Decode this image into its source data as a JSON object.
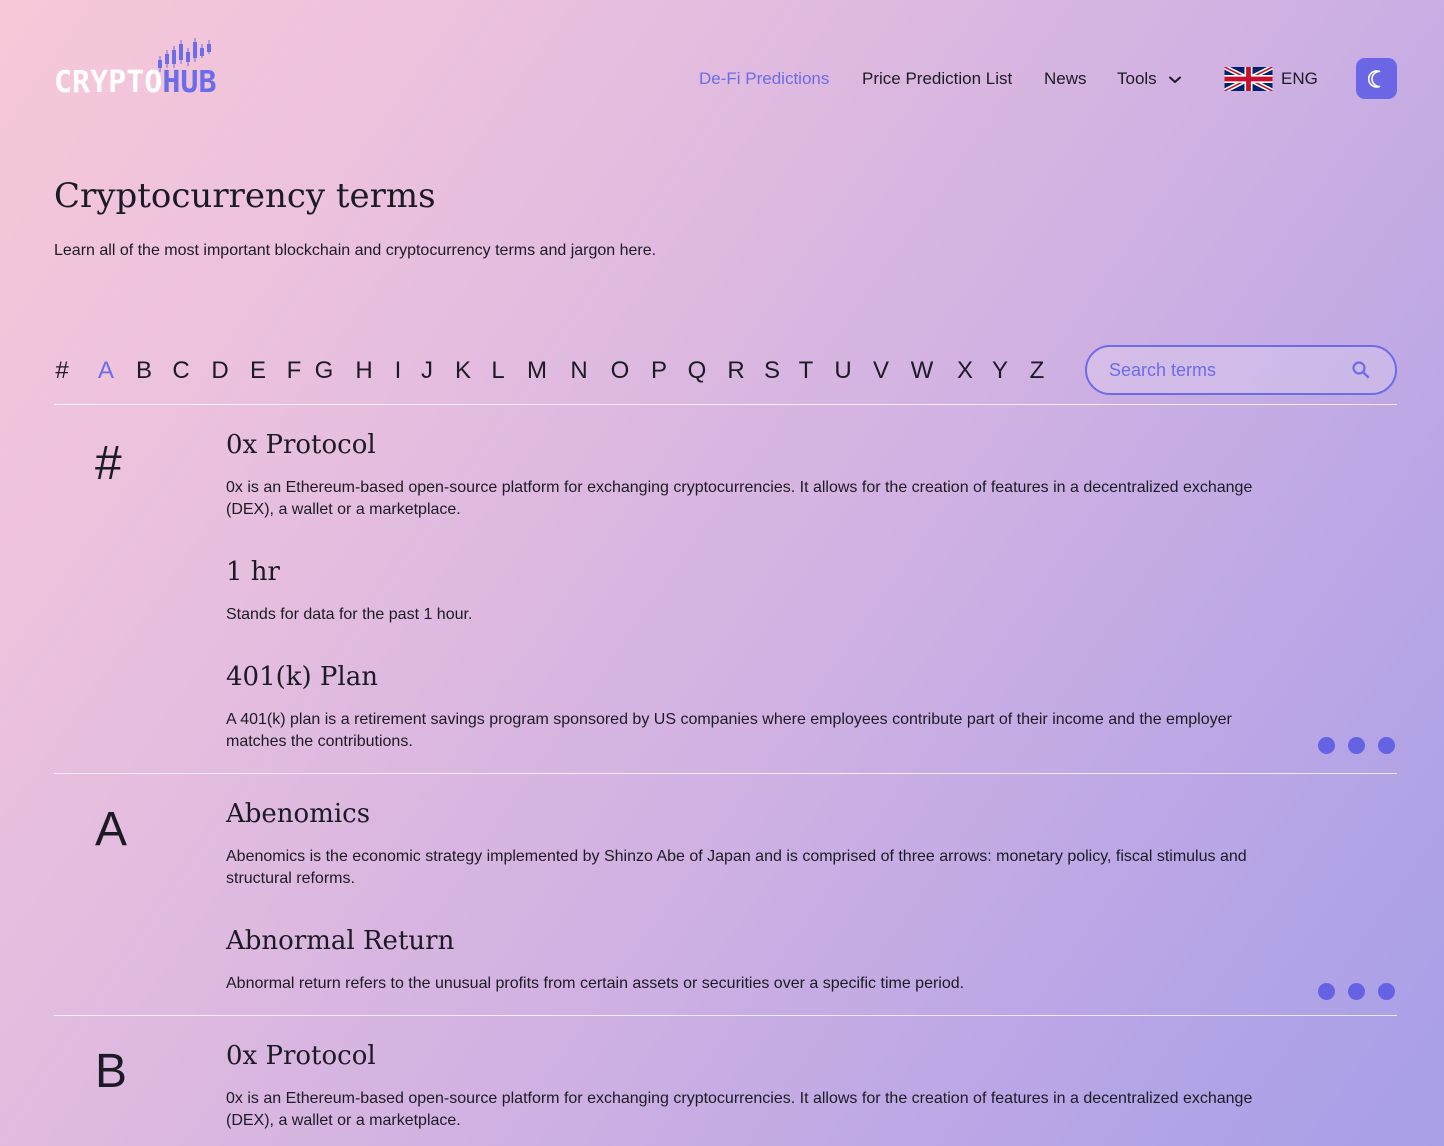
{
  "brand": {
    "name_part1": "CRYPTO",
    "name_part2": "HUB",
    "accent": "#6c6ce6"
  },
  "nav": {
    "items": [
      {
        "label": "De-Fi Predictions",
        "active": true
      },
      {
        "label": "Price Prediction List",
        "active": false
      },
      {
        "label": "News",
        "active": false
      },
      {
        "label": "Tools",
        "active": false,
        "has_dropdown": true
      }
    ],
    "language": {
      "label": "ENG",
      "flag": "uk-flag-icon"
    },
    "theme_toggle": {
      "icon": "moon-icon"
    }
  },
  "page": {
    "title": "Cryptocurrency terms",
    "subtitle": "Learn all of the most important blockchain and cryptocurrency terms and jargon here."
  },
  "alphabet": {
    "letters": [
      "#",
      "A",
      "B",
      "C",
      "D",
      "E",
      "F",
      "G",
      "H",
      "I",
      "J",
      "K",
      "L",
      "M",
      "N",
      "O",
      "P",
      "Q",
      "R",
      "S",
      "T",
      "U",
      "V",
      "W",
      "X",
      "Y",
      "Z"
    ],
    "active": "A"
  },
  "search": {
    "placeholder": "Search terms",
    "value": ""
  },
  "sections": [
    {
      "letter": "#",
      "terms": [
        {
          "title": "0x Protocol",
          "description": "0x is an Ethereum-based open-source platform for exchanging cryptocurrencies. It allows for the creation of features in a decentralized exchange (DEX), a wallet or a marketplace."
        },
        {
          "title": "1 hr",
          "description": "Stands for data for the past 1 hour."
        },
        {
          "title": "401(k) Plan",
          "description": "A 401(k) plan is a retirement savings program sponsored by US companies where employees contribute part of their income and the employer matches the contributions."
        }
      ]
    },
    {
      "letter": "A",
      "terms": [
        {
          "title": "Abenomics",
          "description": "Abenomics is the economic strategy implemented by Shinzo Abe of Japan and is comprised of three arrows: monetary policy, fiscal stimulus and structural reforms."
        },
        {
          "title": "Abnormal Return",
          "description": "Abnormal return refers to the unusual profits from certain assets or securities over a specific time period."
        }
      ]
    },
    {
      "letter": "B",
      "terms": [
        {
          "title": "0x Protocol",
          "description": "0x is an Ethereum-based open-source platform for exchanging cryptocurrencies. It allows for the creation of features in a decentralized exchange (DEX), a wallet or a marketplace."
        }
      ]
    }
  ]
}
